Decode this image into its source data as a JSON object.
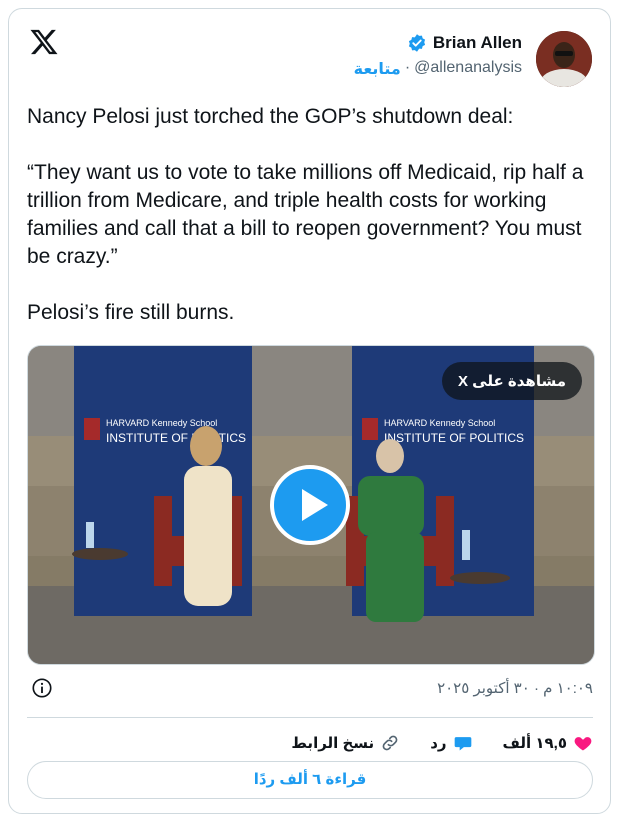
{
  "author": {
    "display_name": "Brian Allen",
    "handle": "@allenanalysis",
    "follow_label": "متابعة",
    "separator": "·"
  },
  "tweet": {
    "text": "Nancy Pelosi just torched the GOP’s shutdown deal:\n\n“They want us to vote to take millions off Medicaid, rip half a trillion from Medicare, and triple health costs for working families and call that a bill to reopen government? You must be crazy.”\n\nPelosi’s fire still burns."
  },
  "media": {
    "watch_on_x_label": "مشاهدة على X",
    "banner_left_line1": "HARVARD Kennedy School",
    "banner_left_line2": "INSTITUTE OF POLITICS",
    "banner_right_line1": "HARVARD Kennedy School",
    "banner_right_line2": "INSTITUTE OF POLITICS"
  },
  "meta": {
    "timestamp": "١٠:٠٩ م · ٣٠ أكتوبر ٢٠٢٥"
  },
  "actions": {
    "likes_count": "١٩,٥ ألف",
    "reply_label": "رد",
    "copy_link_label": "نسخ الرابط"
  },
  "read_replies_label": "قراءة ٦ ألف ردًا",
  "colors": {
    "accent": "#1d9bf0",
    "like": "#f91880",
    "secondary_text": "#536471",
    "border": "#cfd9de"
  }
}
